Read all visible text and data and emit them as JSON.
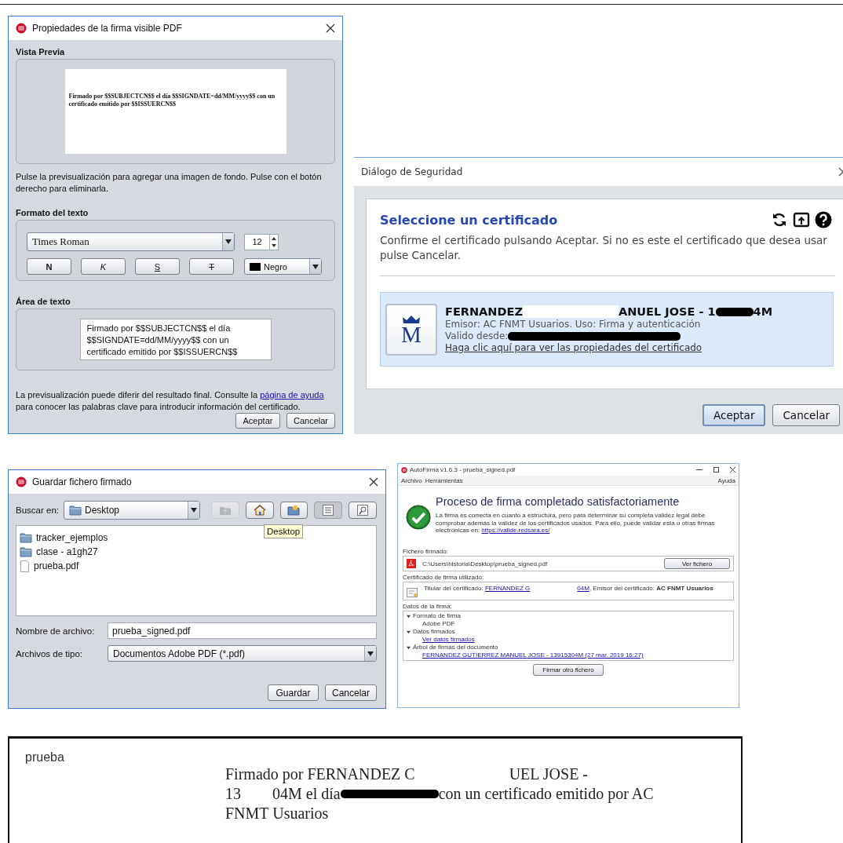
{
  "properties_dialog": {
    "title": "Propiedades de la firma visible PDF",
    "preview_label": "Vista Previa",
    "preview_text": "Firmado por $$SUBJECTCN$$ el día $$SIGNDATE=dd/MM/yyyy$$ con un certificado emitido por $$ISSUERCN$$",
    "hint": "Pulse la previsualización para agregar una imagen de fondo. Pulse con el botón derecho para eliminarla.",
    "format_label": "Formato del texto",
    "font": "Times Roman",
    "size": "12",
    "style_buttons": [
      {
        "label": "N",
        "kind": "bold"
      },
      {
        "label": "K",
        "kind": "italic"
      },
      {
        "label": "S",
        "kind": "underline"
      },
      {
        "label": "T",
        "kind": "strike"
      }
    ],
    "color_name": "Negro",
    "text_area_label": "Área de texto",
    "text_area_value": "Firmado por $$SUBJECTCN$$ el día $$SIGNDATE=dd/MM/yyyy$$ con un certificado emitido por $$ISSUERCN$$",
    "note": {
      "before": "La previsualización puede diferir del resultado final. Consulte la ",
      "link": "página de ayuda",
      "after": " para conocer las palabras clave para introducir información del certificado."
    },
    "buttons": [
      "Aceptar",
      "Cancelar"
    ]
  },
  "security_dialog": {
    "title": "Diálogo de Seguridad",
    "heading": "Seleccione un certificado",
    "message": "Confirme el certificado pulsando Aceptar. Si no es este el certificado que desea usar pulse Cancelar.",
    "certificate": {
      "selected": true,
      "logo_letter": "M",
      "name": [
        {
          "kind": "text",
          "text": "FERNANDEZ"
        },
        {
          "kind": "blank"
        },
        {
          "kind": "text",
          "text": "ANUEL JOSE - 1"
        },
        {
          "kind": "blackout"
        },
        {
          "kind": "text",
          "text": "4M"
        }
      ],
      "issuer": "Emisor: AC FNMT Usuarios. Uso: Firma y autenticación",
      "valid": [
        {
          "kind": "text",
          "text": "Valido desde:"
        },
        {
          "kind": "blackout"
        }
      ],
      "link": "Haga clic aquí para ver las propiedades del certificado"
    },
    "buttons": [
      {
        "label": "Aceptar",
        "default": true
      },
      {
        "label": "Cancelar",
        "default": false
      }
    ]
  },
  "save_dialog": {
    "title": "Guardar fichero firmado",
    "look_in_label": "Buscar en:",
    "look_in": "Desktop",
    "toolbar": [
      {
        "kind": "up",
        "disabled": true,
        "selected": false
      },
      {
        "kind": "home",
        "disabled": false,
        "selected": false
      },
      {
        "kind": "new-folder",
        "disabled": false,
        "selected": false
      },
      {
        "kind": "list",
        "disabled": false,
        "selected": true
      },
      {
        "kind": "details",
        "disabled": false,
        "selected": false
      }
    ],
    "tooltip": "Desktop",
    "files": [
      {
        "name": "tracker_ejemplos",
        "kind": "folder"
      },
      {
        "name": "clase - a1gh27",
        "kind": "folder"
      },
      {
        "name": "prueba.pdf",
        "kind": "file"
      }
    ],
    "file_name_label": "Nombre de archivo:",
    "file_name": "prueba_signed.pdf",
    "file_type_label": "Archivos de tipo:",
    "file_type": "Documentos Adobe PDF (*.pdf)",
    "buttons": [
      "Guardar",
      "Cancelar"
    ]
  },
  "autofirma_window": {
    "title": "AutoFirma v1.6.3 - prueba_signed.pdf",
    "menu": [
      "Archivo",
      "Herramientas"
    ],
    "menu_right": "Ayuda",
    "heading": "Proceso de firma completado satisfactoriamente",
    "body": "La firma es correcta en cuanto a estructura, pero para determinar su completa validez legal debe comprobar además la validez de los certificados usados. Para ello, puede validar esta u otras firmas electrónicas en: ",
    "body_link": "https://valide.redsara.es/",
    "file_label": "Fichero firmado:",
    "file_path": "C:\\Users\\historia\\Desktop\\prueba_signed.pdf",
    "view_button": "Ver fichero",
    "cert_label": "Certificado de firma utilizado:",
    "cert_line": [
      {
        "kind": "text",
        "text": "Titular del certificado: "
      },
      {
        "kind": "link",
        "text": "FERNANDEZ G"
      },
      {
        "kind": "blank"
      },
      {
        "kind": "link",
        "text": "04M"
      },
      {
        "kind": "text",
        "text": ", Emisor del certificado: "
      },
      {
        "kind": "bold",
        "text": "AC FNMT Usuarios"
      }
    ],
    "data_label": "Datos de la firma:",
    "tree": [
      {
        "label": "Formato de firma",
        "expanded": true,
        "children": [
          {
            "label": "Adobe PDF",
            "kind": "text"
          }
        ]
      },
      {
        "label": "Datos firmados",
        "expanded": true,
        "children": [
          {
            "label": "Ver datos firmados",
            "kind": "link"
          }
        ]
      },
      {
        "label": "Árbol de firmas del documento",
        "expanded": true,
        "children": [
          {
            "label": "FERNANDEZ GUTIERREZ MANUEL JOSE - 13915304M (27 mar. 2019 16:27)",
            "kind": "link"
          }
        ]
      }
    ],
    "sign_again": "Firmar otro fichero"
  },
  "document": {
    "title": "prueba",
    "lines": [
      [
        {
          "kind": "text",
          "text": "Firmado por FERNANDEZ C"
        },
        {
          "kind": "blank"
        },
        {
          "kind": "text",
          "text": "UEL JOSE -"
        }
      ],
      [
        {
          "kind": "text",
          "text": "13"
        },
        {
          "kind": "blank"
        },
        {
          "kind": "text",
          "text": "04M el día"
        },
        {
          "kind": "blackout"
        },
        {
          "kind": "text",
          "text": "con un certificado emitido por AC"
        }
      ],
      [
        {
          "kind": "text",
          "text": "FNMT Usuarios"
        }
      ]
    ]
  }
}
